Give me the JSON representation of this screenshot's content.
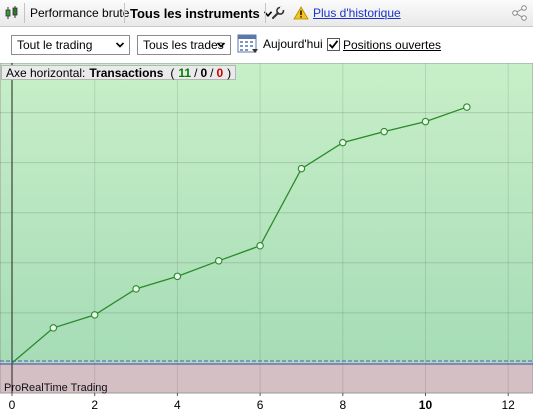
{
  "toolbar": {
    "perf_label": "Performance brute",
    "instruments_label": "Tous les instruments",
    "history_link": "Plus d'historique"
  },
  "filters": {
    "trading_select": "Tout le trading",
    "trades_select": "Tous les trades",
    "today_label": "Aujourd'hui",
    "positions_label": "Positions ouvertes",
    "positions_checked": true
  },
  "chart": {
    "axis_prefix": "Axe horizontal:",
    "axis_name": "Transactions",
    "count_open": "(",
    "count_win": "11",
    "count_sep1": "/",
    "count_neutral": "0",
    "count_sep2": "/",
    "count_loss": "0",
    "count_close": ")",
    "watermark": "ProRealTime Trading",
    "colors": {
      "positive_bg_top": "#c8efc8",
      "positive_bg_bottom": "#a6dcb6",
      "negative_bg": "#d4bfc4",
      "line": "#2a8a2a",
      "win": "#008000",
      "loss": "#cc0000"
    }
  },
  "chart_data": {
    "type": "line",
    "x": [
      0,
      1,
      2,
      3,
      4,
      5,
      6,
      7,
      8,
      9,
      10,
      11
    ],
    "values": [
      0,
      0.7,
      0.96,
      1.48,
      1.73,
      2.04,
      2.34,
      3.88,
      4.4,
      4.62,
      4.82,
      5.11
    ],
    "xlim": [
      0,
      12.6
    ],
    "ylim": [
      -0.6,
      5.95
    ],
    "x_ticks": [
      0,
      2,
      4,
      6,
      8,
      10,
      12
    ],
    "x_tick_labels": [
      "0",
      "2",
      "4",
      "6",
      "8",
      "10",
      "12"
    ],
    "bold_tick": "10",
    "grid": true
  }
}
